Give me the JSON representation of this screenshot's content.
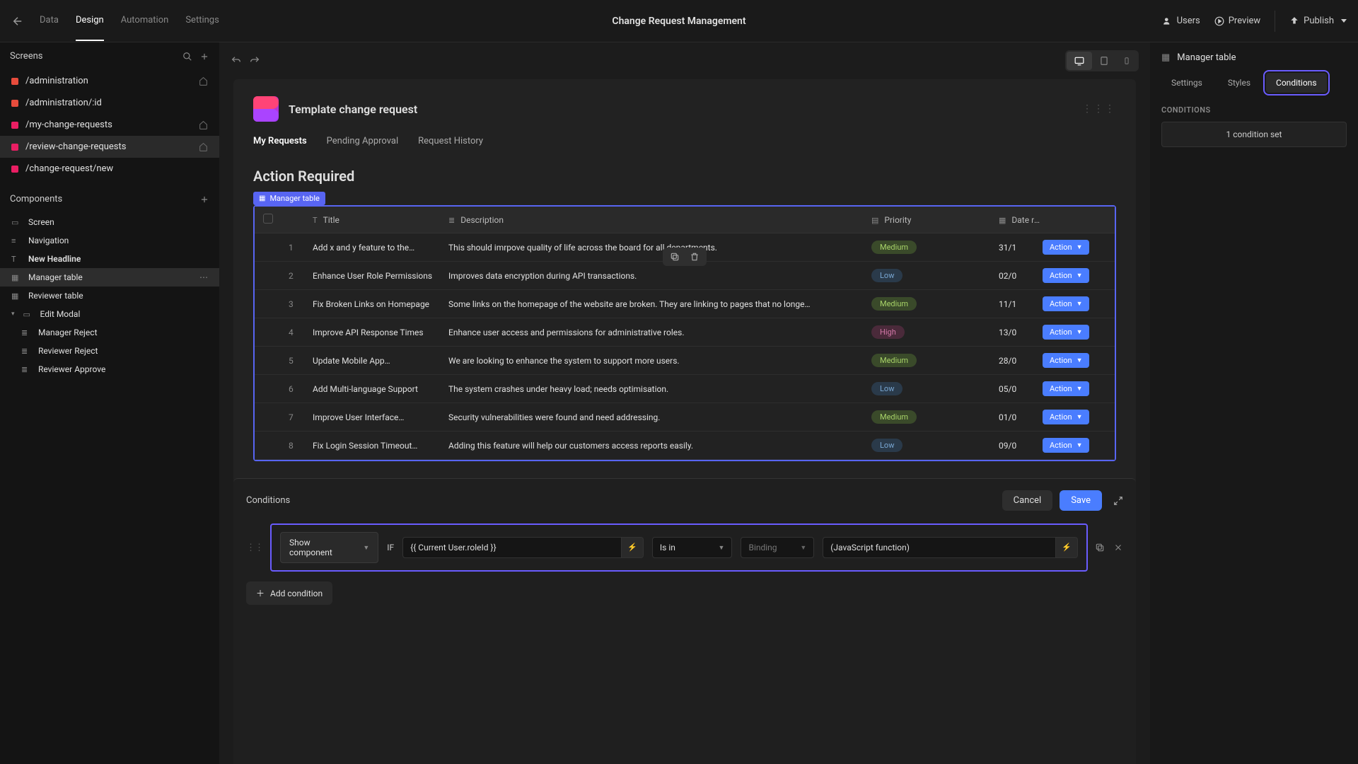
{
  "topbar": {
    "nav": [
      "Data",
      "Design",
      "Automation",
      "Settings"
    ],
    "nav_active": 1,
    "title": "Change Request Management",
    "users": "Users",
    "preview": "Preview",
    "publish": "Publish"
  },
  "left": {
    "screens_title": "Screens",
    "screens": [
      {
        "name": "/administration",
        "color": "dot-red",
        "home": true
      },
      {
        "name": "/administration/:id",
        "color": "dot-red",
        "home": false
      },
      {
        "name": "/my-change-requests",
        "color": "dot-pink",
        "home": true
      },
      {
        "name": "/review-change-requests",
        "color": "dot-pink",
        "home": true,
        "selected": true
      },
      {
        "name": "/change-request/new",
        "color": "dot-pink",
        "home": false
      }
    ],
    "components_title": "Components",
    "components": [
      {
        "label": "Screen",
        "icon": "▭",
        "indent": 0
      },
      {
        "label": "Navigation",
        "icon": "≡",
        "indent": 0
      },
      {
        "label": "New Headline",
        "icon": "T",
        "indent": 0,
        "bold": true
      },
      {
        "label": "Manager table",
        "icon": "▦",
        "indent": 0,
        "selected": true,
        "dots": true
      },
      {
        "label": "Reviewer table",
        "icon": "▦",
        "indent": 0
      },
      {
        "label": "Edit Modal",
        "icon": "▭",
        "indent": 0,
        "expand": true
      },
      {
        "label": "Manager Reject",
        "icon": "≣",
        "indent": 1
      },
      {
        "label": "Reviewer Reject",
        "icon": "≣",
        "indent": 1
      },
      {
        "label": "Reviewer Approve",
        "icon": "≣",
        "indent": 1
      }
    ]
  },
  "canvas": {
    "app_title": "Template change request",
    "tabs": [
      "My Requests",
      "Pending Approval",
      "Request History"
    ],
    "tab_active": 0,
    "section": "Action Required",
    "sel_label": "Manager table",
    "columns": {
      "title": "Title",
      "desc": "Description",
      "prio": "Priority",
      "date": "Date required"
    },
    "action_label": "Action",
    "rows": [
      {
        "n": "1",
        "title": "Add x and y feature to the…",
        "desc": "This should imrpove quality of life across the board for all departments.",
        "prio": "Medium",
        "date": "31/1"
      },
      {
        "n": "2",
        "title": "Enhance User Role Permissions",
        "desc": "Improves data encryption during API transactions.",
        "prio": "Low",
        "date": "02/0"
      },
      {
        "n": "3",
        "title": "Fix Broken Links on Homepage",
        "desc": "Some links on the homepage of the website are broken. They are linking to pages that no longe…",
        "prio": "Medium",
        "date": "11/1"
      },
      {
        "n": "4",
        "title": "Improve API Response Times",
        "desc": "Enhance user access and permissions for administrative roles.",
        "prio": "High",
        "date": "13/0"
      },
      {
        "n": "5",
        "title": "Update Mobile App…",
        "desc": "We are looking to enhance the system to support more users.",
        "prio": "Medium",
        "date": "28/0"
      },
      {
        "n": "6",
        "title": "Add Multi-language Support",
        "desc": "The system crashes under heavy load; needs optimisation.",
        "prio": "Low",
        "date": "05/0"
      },
      {
        "n": "7",
        "title": "Improve User Interface…",
        "desc": "Security vulnerabilities were found and need addressing.",
        "prio": "Medium",
        "date": "01/0"
      },
      {
        "n": "8",
        "title": "Fix Login Session Timeout…",
        "desc": "Adding this feature will help our customers access reports easily.",
        "prio": "Low",
        "date": "09/0"
      }
    ]
  },
  "cond_panel": {
    "title": "Conditions",
    "cancel": "Cancel",
    "save": "Save",
    "show_component": "Show component",
    "if": "IF",
    "lhs": "{{ Current User.roleId }}",
    "op": "Is in",
    "binding": "Binding",
    "rhs": "(JavaScript function)",
    "add": "Add condition"
  },
  "right": {
    "title": "Manager table",
    "tabs": [
      "Settings",
      "Styles",
      "Conditions"
    ],
    "tab_active": 2,
    "section": "CONDITIONS",
    "set_label": "1 condition set"
  },
  "prio_class": {
    "Medium": "badge-medium",
    "Low": "badge-low",
    "High": "badge-high"
  }
}
